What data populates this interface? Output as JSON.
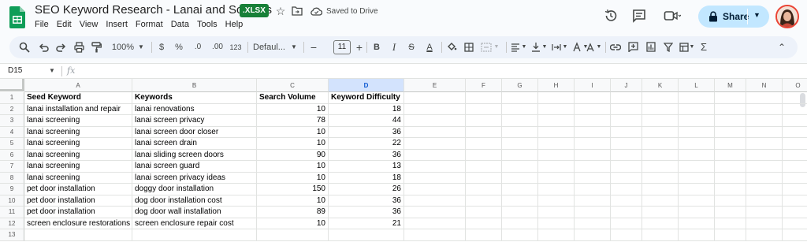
{
  "app": {
    "title": "SEO Keyword Research - Lanai and Screens",
    "badge": ".XLSX",
    "saved_status": "Saved to Drive",
    "menu": [
      "File",
      "Edit",
      "View",
      "Insert",
      "Format",
      "Data",
      "Tools",
      "Help"
    ],
    "share_label": "Share",
    "brand_color": "#188038",
    "share_color": "#c2e7ff"
  },
  "toolbar": {
    "zoom": "100%",
    "currency": "$",
    "percent": "%",
    "dec_decrease": ".0",
    "dec_increase": ".00",
    "more_formats": "123",
    "font": "Defaul...",
    "font_size": "11",
    "minus": "−",
    "plus": "+",
    "bold": "B",
    "italic": "I",
    "strike": "S",
    "text_color": "A"
  },
  "formula_bar": {
    "cell_ref": "D15",
    "fx": "fx",
    "content": ""
  },
  "sheet": {
    "columns": [
      "A",
      "B",
      "C",
      "D",
      "E",
      "F",
      "G",
      "H",
      "I",
      "J",
      "K",
      "L",
      "M",
      "N",
      "O"
    ],
    "selected_column": "D",
    "row_numbers": [
      "1",
      "2",
      "3",
      "4",
      "5",
      "6",
      "7",
      "8",
      "9",
      "10",
      "11",
      "12",
      "13"
    ],
    "header": [
      "Seed Keyword",
      "Keywords",
      "Search Volume",
      "Keyword Difficulty"
    ],
    "rows": [
      [
        "lanai installation and repair",
        "lanai renovations",
        "10",
        "18"
      ],
      [
        "lanai screening",
        "lanai screen privacy",
        "78",
        "44"
      ],
      [
        "lanai screening",
        "lanai screen door closer",
        "10",
        "36"
      ],
      [
        "lanai screening",
        "lanai screen drain",
        "10",
        "22"
      ],
      [
        "lanai screening",
        "lanai sliding screen doors",
        "90",
        "36"
      ],
      [
        "lanai screening",
        "lanai screen guard",
        "10",
        "13"
      ],
      [
        "lanai screening",
        "lanai screen privacy ideas",
        "10",
        "18"
      ],
      [
        "pet door installation",
        "doggy door installation",
        "150",
        "26"
      ],
      [
        "pet door installation",
        "dog door installation cost",
        "10",
        "36"
      ],
      [
        "pet door installation",
        "dog door wall installation",
        "89",
        "36"
      ],
      [
        "screen enclosure restorations",
        "screen enclosure repair cost",
        "10",
        "21"
      ]
    ]
  }
}
